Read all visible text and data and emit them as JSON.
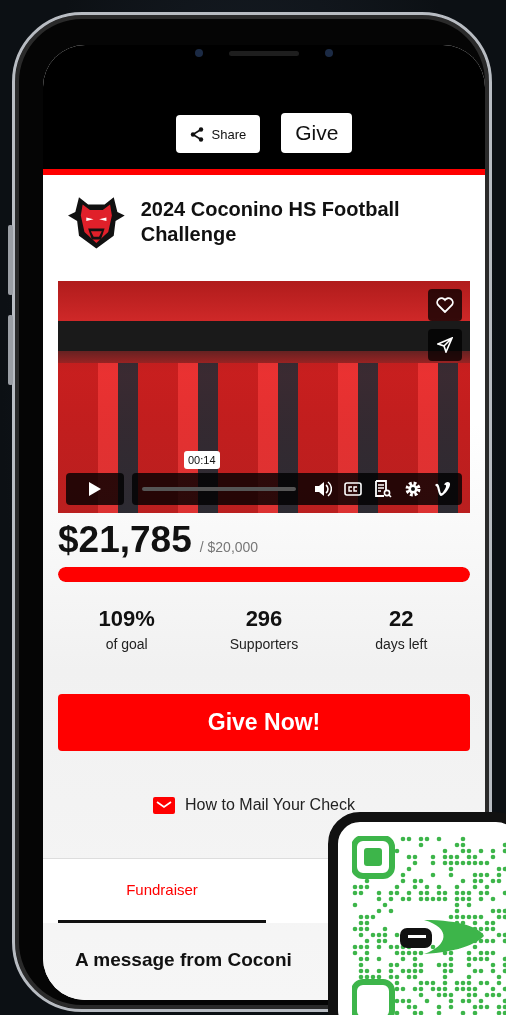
{
  "header": {
    "buttons": [
      {
        "kind": "share",
        "label": "Share"
      },
      {
        "kind": "give",
        "label": "Give"
      }
    ]
  },
  "campaign": {
    "title": "2024 Coconino HS Football Challenge"
  },
  "video": {
    "time": "00:14"
  },
  "amount": {
    "raised": "$21,785",
    "goal": "/ $20,000"
  },
  "progress": {
    "level": 1.0
  },
  "stats": [
    {
      "value": "109%",
      "label": "of goal"
    },
    {
      "value": "296",
      "label": "Supporters"
    },
    {
      "value": "22",
      "label": "days left"
    }
  ],
  "give_button": "Give Now!",
  "mail_link": "How to Mail Your Check",
  "tabs": [
    {
      "label": "Fundraiser",
      "selected": true
    }
  ],
  "message_heading": "A message from Coconi"
}
